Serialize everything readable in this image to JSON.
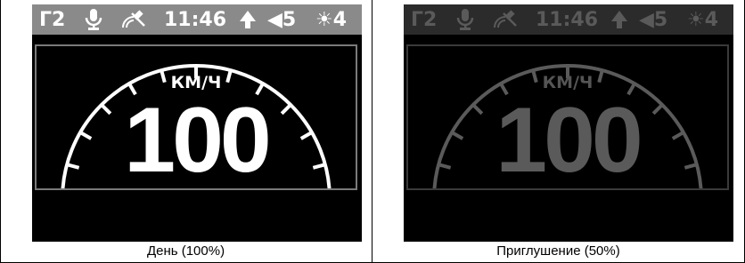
{
  "panels": [
    {
      "mode_label": "Г2",
      "icons": [
        "microphone-icon",
        "satellite-icon",
        "arrow-up-icon",
        "speaker-icon",
        "sun-icon"
      ],
      "time": "11:46",
      "volume": "◀5",
      "brightness": "☀4",
      "speed_unit": "КМ/Ч",
      "speed_value": "100",
      "caption": "День (100%)",
      "colors": {
        "statusbar": "#8a8a8a",
        "gauge": "#ffffff",
        "text": "#ffffff"
      }
    },
    {
      "mode_label": "Г2",
      "icons": [
        "microphone-icon",
        "satellite-icon",
        "arrow-up-icon",
        "speaker-icon",
        "sun-icon"
      ],
      "time": "11:46",
      "volume": "◀5",
      "brightness": "☀4",
      "speed_unit": "КМ/Ч",
      "speed_value": "100",
      "caption": "Приглушение (50%)",
      "colors": {
        "statusbar": "#2b2b2b",
        "gauge": "#5a5a5a",
        "text": "#5a5a5a"
      }
    }
  ]
}
